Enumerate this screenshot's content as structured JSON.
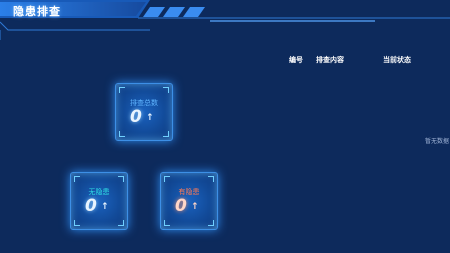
{
  "panel": {
    "title": "隐患排查"
  },
  "table": {
    "headers": [
      "编号",
      "排查内容",
      "当前状态"
    ],
    "empty_text": "暂无数据"
  },
  "stats": {
    "total": {
      "label": "排查总数",
      "value": "0",
      "label_color": "#5fb4ff"
    },
    "none": {
      "label": "无隐患",
      "value": "0",
      "label_color": "#2fe0e6"
    },
    "has": {
      "label": "有隐患",
      "value": "0",
      "label_color": "#ff7a55"
    }
  }
}
